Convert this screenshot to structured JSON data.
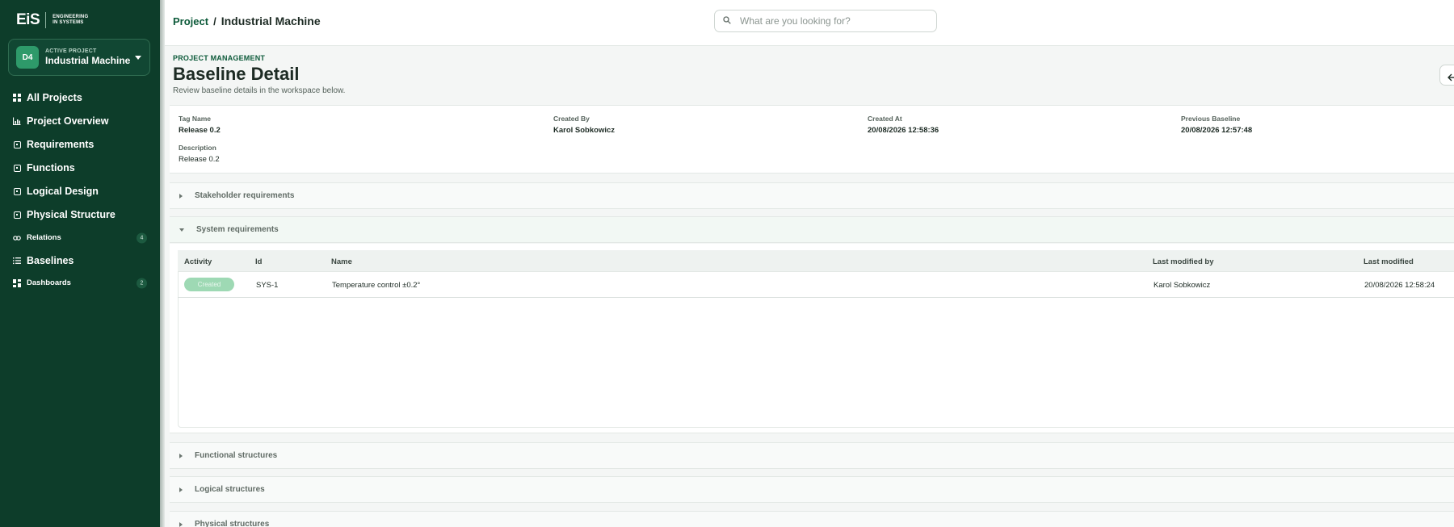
{
  "brand": {
    "mark": "EiS",
    "tagline_line1": "ENGINEERING",
    "tagline_line2": "IN SYSTEMS"
  },
  "active_project": {
    "kicker": "ACTIVE PROJECT",
    "initials": "D4",
    "name": "Industrial Machine"
  },
  "sidebar": {
    "items": [
      {
        "label": "All Projects",
        "icon": "grid-icon"
      },
      {
        "label": "Project Overview",
        "icon": "bar-chart-icon"
      },
      {
        "label": "Requirements",
        "icon": "square-dot-icon"
      },
      {
        "label": "Functions",
        "icon": "square-dot-icon"
      },
      {
        "label": "Logical Design",
        "icon": "square-dot-icon"
      },
      {
        "label": "Physical Structure",
        "icon": "square-dot-icon"
      },
      {
        "label": "Relations",
        "icon": "link-icon",
        "count": "4"
      },
      {
        "label": "Baselines",
        "icon": "list-icon"
      },
      {
        "label": "Dashboards",
        "icon": "dashboard-icon",
        "count": "2"
      }
    ]
  },
  "breadcrumb": {
    "root": "Project",
    "separator": "/",
    "current": "Industrial Machine"
  },
  "search": {
    "placeholder": "What are you looking for?"
  },
  "header": {
    "kicker": "PROJECT MANAGEMENT",
    "title": "Baseline Detail",
    "subtitle": "Review baseline details in the workspace below."
  },
  "details": {
    "tag_name_label": "Tag Name",
    "tag_name": "Release 0.2",
    "created_by_label": "Created By",
    "created_by": "Karol Sobkowicz",
    "created_at_label": "Created At",
    "created_at": "20/08/2026 12:58:36",
    "previous_baseline_label": "Previous Baseline",
    "previous_baseline": "20/08/2026 12:57:48",
    "description_label": "Description",
    "description": "Release 0.2"
  },
  "sections": [
    {
      "label": "Stakeholder requirements",
      "expanded": false
    },
    {
      "label": "System requirements",
      "expanded": true
    },
    {
      "label": "Functional structures",
      "expanded": false
    },
    {
      "label": "Logical structures",
      "expanded": false
    },
    {
      "label": "Physical structures",
      "expanded": false
    }
  ],
  "table": {
    "columns": [
      "Activity",
      "Id",
      "Name",
      "Last modified by",
      "Last modified"
    ],
    "rows": [
      {
        "activity": "Created",
        "id": "SYS-1",
        "name": "Temperature control ±0.2°",
        "last_modified_by": "Karol Sobkowicz",
        "last_modified": "20/08/2026 12:58:24"
      }
    ]
  },
  "colors": {
    "sidebar_bg": "#0d3d2a",
    "accent": "#0d5a3a",
    "badge_created": "#9ed9b4"
  }
}
